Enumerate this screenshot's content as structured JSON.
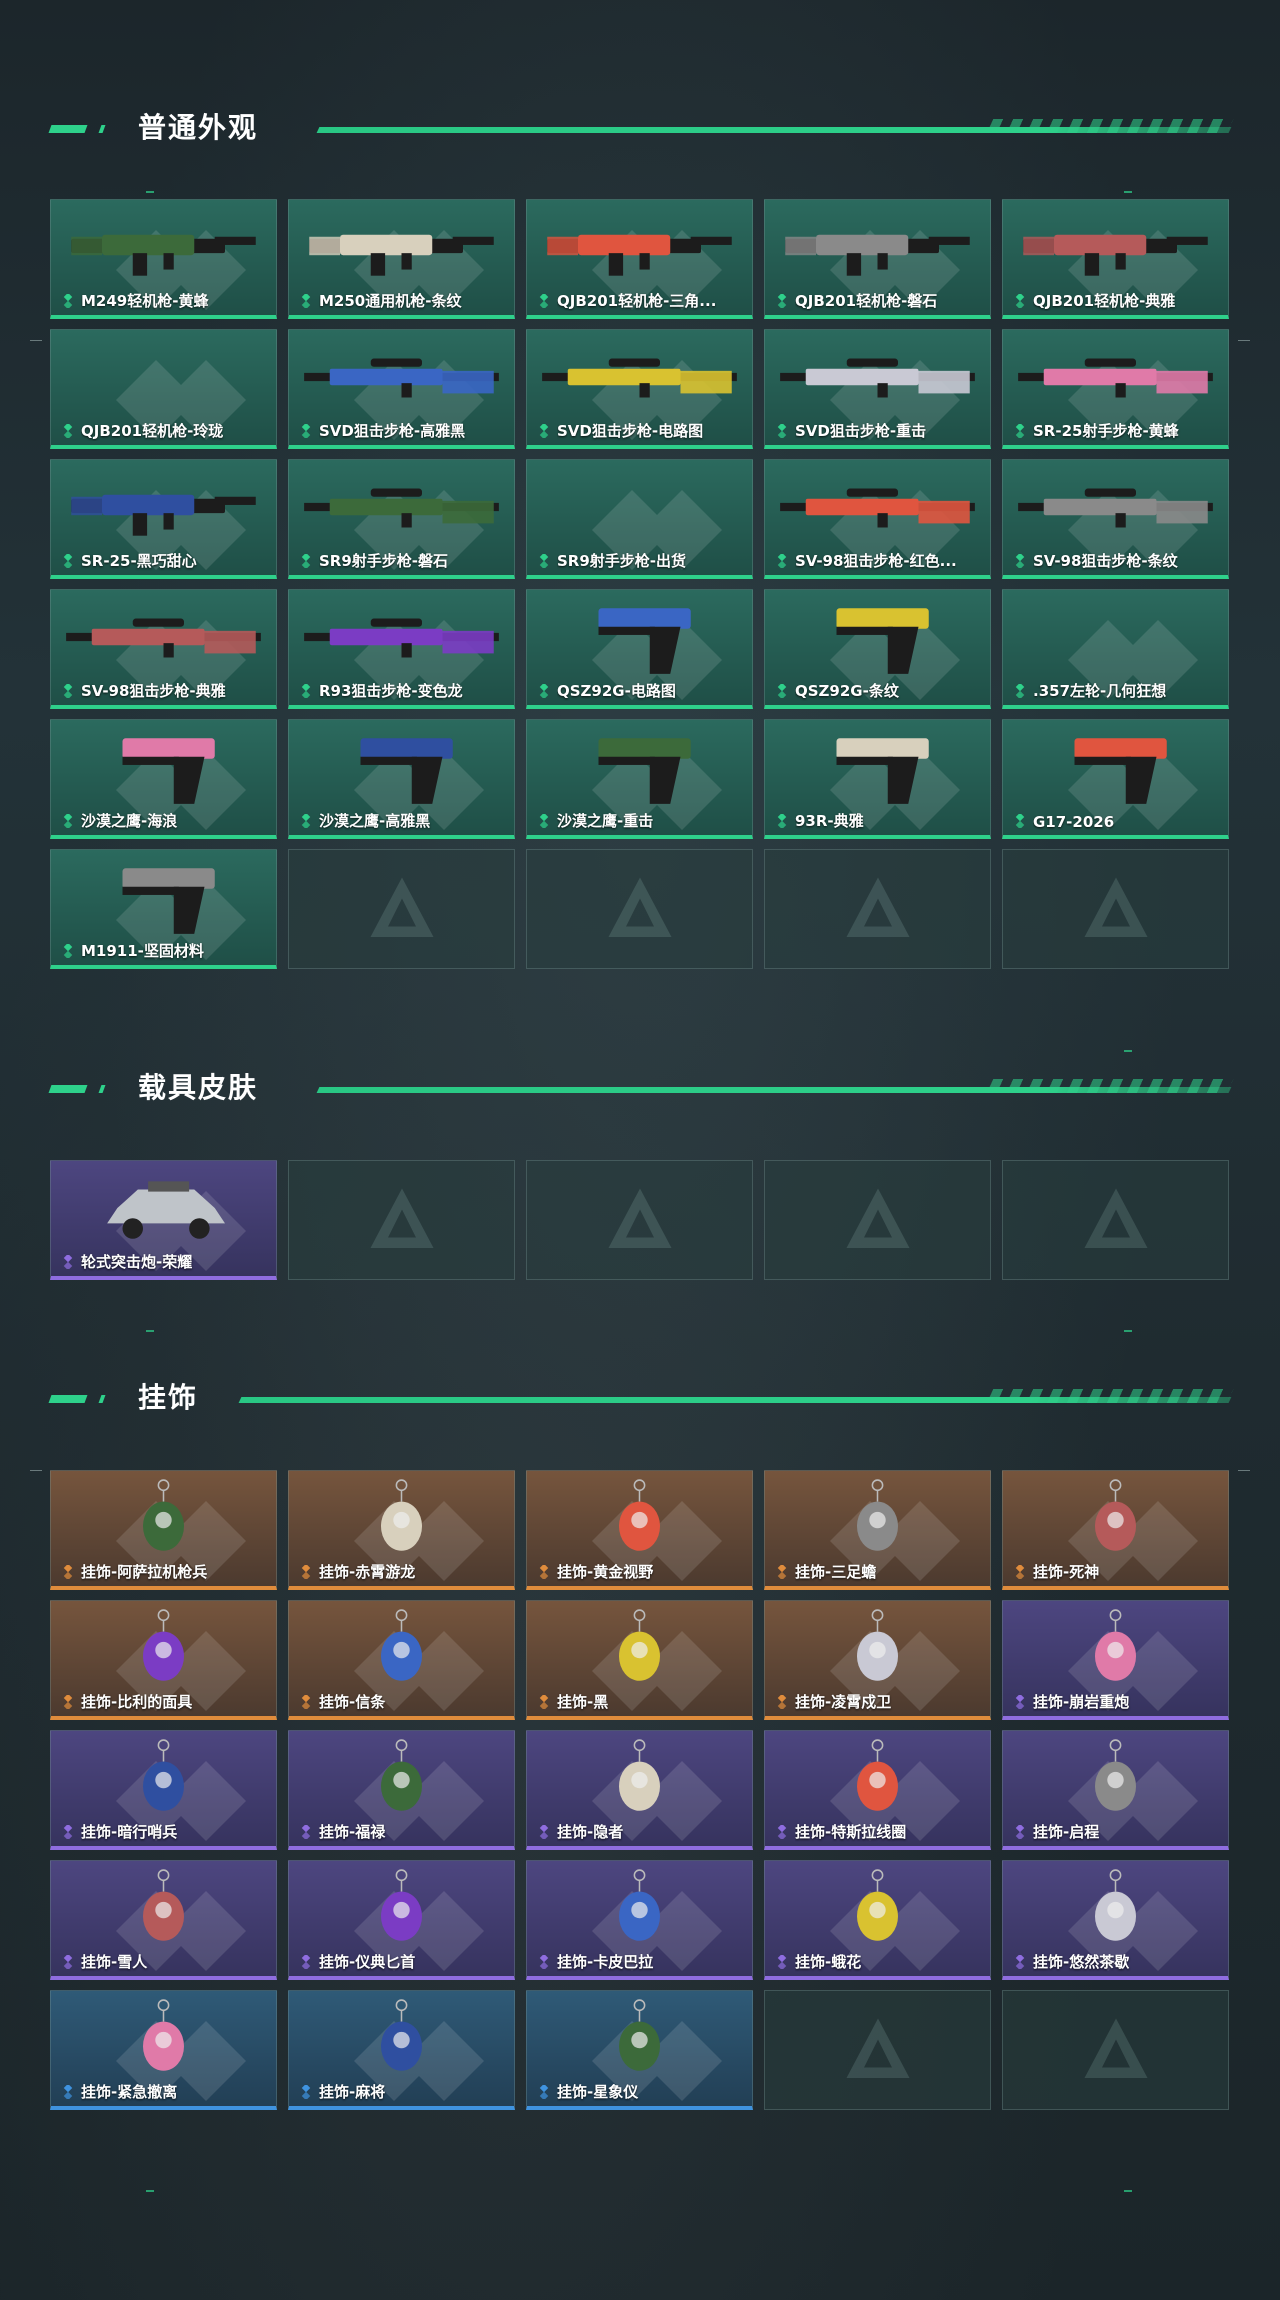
{
  "colors": {
    "accent": "#2ed18b",
    "common": "#2ed18b",
    "rare": "#8f6de0",
    "legendary": "#e08c3c",
    "special": "#3f93e0"
  },
  "sections": {
    "skins": {
      "title": "普通外观"
    },
    "vehicles": {
      "title": "载具皮肤"
    },
    "charms": {
      "title": "挂饰"
    }
  },
  "skins": [
    {
      "name": "M249轻机枪-黄蜂",
      "rarity": "green",
      "icon": "rifle-icon"
    },
    {
      "name": "M250通用机枪-条纹",
      "rarity": "green",
      "icon": "rifle-icon"
    },
    {
      "name": "QJB201轻机枪-三角...",
      "rarity": "green",
      "icon": "rifle-icon"
    },
    {
      "name": "QJB201轻机枪-磐石",
      "rarity": "green",
      "icon": "rifle-icon"
    },
    {
      "name": "QJB201轻机枪-典雅",
      "rarity": "green",
      "icon": "rifle-icon"
    },
    {
      "name": "QJB201轻机枪-玲珑",
      "rarity": "green",
      "icon": "none"
    },
    {
      "name": "SVD狙击步枪-高雅黑",
      "rarity": "green",
      "icon": "sniper-icon"
    },
    {
      "name": "SVD狙击步枪-电路图",
      "rarity": "green",
      "icon": "sniper-icon"
    },
    {
      "name": "SVD狙击步枪-重击",
      "rarity": "green",
      "icon": "sniper-icon"
    },
    {
      "name": "SR-25射手步枪-黄蜂",
      "rarity": "green",
      "icon": "sniper-icon"
    },
    {
      "name": "SR-25-黑巧甜心",
      "rarity": "green",
      "icon": "rifle-icon"
    },
    {
      "name": "SR9射手步枪-磐石",
      "rarity": "green",
      "icon": "sniper-icon"
    },
    {
      "name": "SR9射手步枪-出货",
      "rarity": "green",
      "icon": "none"
    },
    {
      "name": "SV-98狙击步枪-红色...",
      "rarity": "green",
      "icon": "sniper-icon"
    },
    {
      "name": "SV-98狙击步枪-条纹",
      "rarity": "green",
      "icon": "sniper-icon"
    },
    {
      "name": "SV-98狙击步枪-典雅",
      "rarity": "green",
      "icon": "sniper-icon"
    },
    {
      "name": "R93狙击步枪-变色龙",
      "rarity": "green",
      "icon": "sniper-icon"
    },
    {
      "name": "QSZ92G-电路图",
      "rarity": "green",
      "icon": "pistol-icon"
    },
    {
      "name": "QSZ92G-条纹",
      "rarity": "green",
      "icon": "pistol-icon"
    },
    {
      "name": ".357左轮-几何狂想",
      "rarity": "green",
      "icon": "none"
    },
    {
      "name": "沙漠之鹰-海浪",
      "rarity": "green",
      "icon": "pistol-icon"
    },
    {
      "name": "沙漠之鹰-高雅黑",
      "rarity": "green",
      "icon": "pistol-icon"
    },
    {
      "name": "沙漠之鹰-重击",
      "rarity": "green",
      "icon": "pistol-icon"
    },
    {
      "name": "93R-典雅",
      "rarity": "green",
      "icon": "pistol-icon"
    },
    {
      "name": "G17-2026",
      "rarity": "green",
      "icon": "pistol-icon"
    },
    {
      "name": "M1911-坚固材料",
      "rarity": "green",
      "icon": "pistol-icon"
    }
  ],
  "vehicles": [
    {
      "name": "轮式突击炮-荣耀",
      "rarity": "purple",
      "icon": "vehicle-icon"
    }
  ],
  "charms": [
    {
      "name": "挂饰-阿萨拉机枪兵",
      "rarity": "orange"
    },
    {
      "name": "挂饰-赤霄游龙",
      "rarity": "orange"
    },
    {
      "name": "挂饰-黄金视野",
      "rarity": "orange"
    },
    {
      "name": "挂饰-三足蟾",
      "rarity": "orange"
    },
    {
      "name": "挂饰-死神",
      "rarity": "orange"
    },
    {
      "name": "挂饰-比利的面具",
      "rarity": "orange"
    },
    {
      "name": "挂饰-信条",
      "rarity": "orange"
    },
    {
      "name": "挂饰-黑",
      "rarity": "orange"
    },
    {
      "name": "挂饰-凌霄戍卫",
      "rarity": "orange"
    },
    {
      "name": "挂饰-崩岩重炮",
      "rarity": "purple"
    },
    {
      "name": "挂饰-暗行哨兵",
      "rarity": "purple"
    },
    {
      "name": "挂饰-福禄",
      "rarity": "purple"
    },
    {
      "name": "挂饰-隐者",
      "rarity": "purple"
    },
    {
      "name": "挂饰-特斯拉线圈",
      "rarity": "purple"
    },
    {
      "name": "挂饰-启程",
      "rarity": "purple"
    },
    {
      "name": "挂饰-雪人",
      "rarity": "purple"
    },
    {
      "name": "挂饰-仪典匕首",
      "rarity": "purple"
    },
    {
      "name": "挂饰-卡皮巴拉",
      "rarity": "purple"
    },
    {
      "name": "挂饰-蛾花",
      "rarity": "purple"
    },
    {
      "name": "挂饰-悠然茶歇",
      "rarity": "purple"
    },
    {
      "name": "挂饰-紧急撤离",
      "rarity": "blue"
    },
    {
      "name": "挂饰-麻将",
      "rarity": "blue"
    },
    {
      "name": "挂饰-星象仪",
      "rarity": "blue"
    }
  ]
}
